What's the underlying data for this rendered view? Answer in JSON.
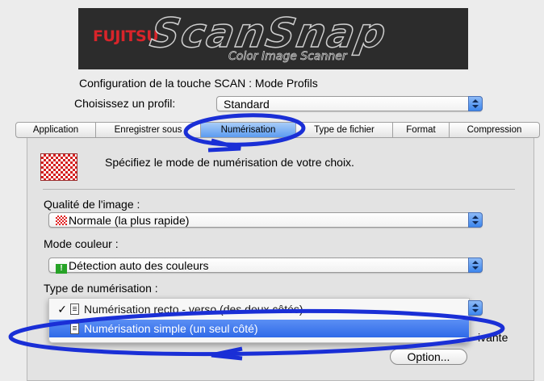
{
  "banner": {
    "vendor_logo": "FUJITSU",
    "product_name": "ScanSnap",
    "product_subtitle": "Color Image Scanner"
  },
  "header": {
    "config_title": "Configuration de la touche SCAN : Mode Profils",
    "profile_label": "Choisissez un profil:",
    "profile_value": "Standard"
  },
  "tabs": [
    {
      "label": "Application"
    },
    {
      "label": "Enregistrer sous"
    },
    {
      "label": "Numérisation"
    },
    {
      "label": "Type de fichier"
    },
    {
      "label": "Format"
    },
    {
      "label": "Compression"
    }
  ],
  "panel": {
    "description": "Spécifiez le mode de numérisation de votre choix.",
    "quality_label": "Qualité de l'image :",
    "quality_value": "Normale (la plus rapide)",
    "color_label": "Mode couleur :",
    "color_value": "Détection auto des couleurs",
    "scan_type_label": "Type de numérisation :",
    "scan_type_options": [
      {
        "label": "Numérisation recto - verso (des deux côtés)",
        "checked": true
      },
      {
        "label": "Numérisation simple (un seul côté)",
        "checked": false
      }
    ],
    "side_fragment": "ivante",
    "option_button": "Option..."
  },
  "icons": {
    "check": "✓",
    "color_mode": "!"
  },
  "colors": {
    "annotation_blue": "#1a2fd6",
    "menu_highlight": "#3a74ea",
    "brand_red": "#d8242a"
  }
}
